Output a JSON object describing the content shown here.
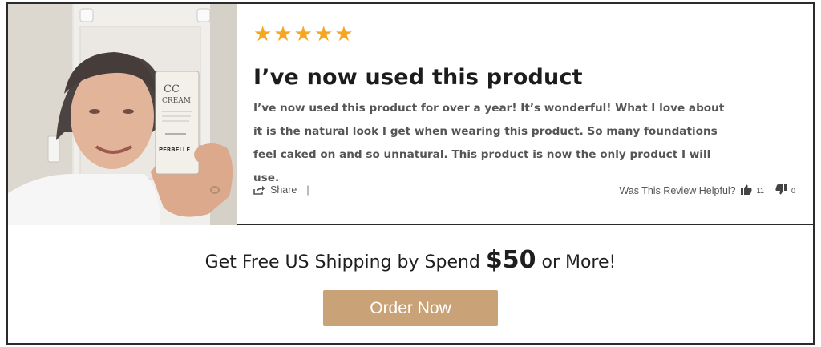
{
  "review": {
    "rating": 5,
    "star_color": "#F5A623",
    "stars": [
      "★",
      "★",
      "★",
      "★",
      "★"
    ],
    "title": "I’ve now used this product",
    "body": "I’ve now used this product for over a year! It’s wonderful! What I love about it is the natural look I get when wearing this product. So many foundations feel caked on and so unnatural. This product is now the only product I will use.",
    "photo": {
      "product_label_line1": "CC",
      "product_label_line2": "CREAM",
      "product_brand": "PERBELLE"
    },
    "actions": {
      "share_icon": "share-arrow-icon",
      "share_label": "Share",
      "separator": "|",
      "helpful_label": "Was This Review Helpful?",
      "upvote_icon": "thumbs-up-icon",
      "upvote_count": "11",
      "downvote_icon": "thumbs-down-icon",
      "downvote_count": "0"
    }
  },
  "promo": {
    "text_before": "Get Free US Shipping by Spend ",
    "price": "$50",
    "text_after": " or More!",
    "button_label": "Order Now",
    "button_color": "#C9A277"
  }
}
